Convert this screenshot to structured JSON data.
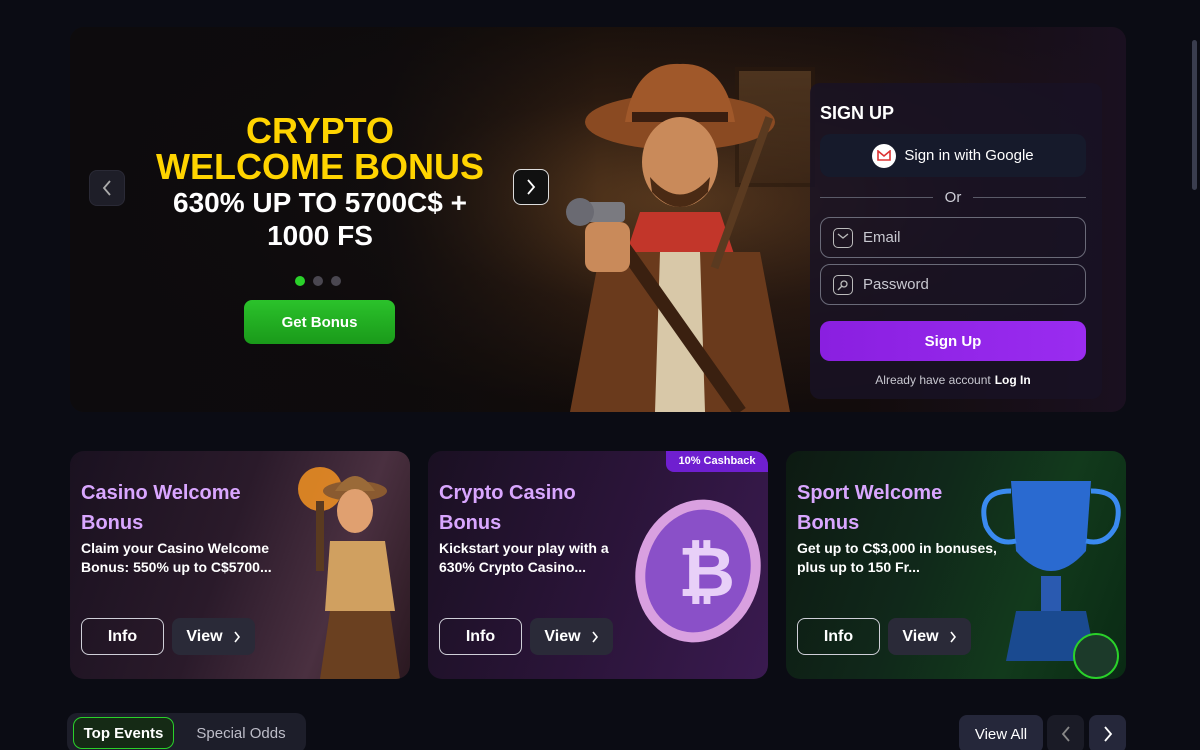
{
  "hero": {
    "promo_line1": "CRYPTO",
    "promo_line2": "WELCOME BONUS",
    "promo_line3": "630% UP TO 5700C$ +",
    "promo_line4": "1000 FS",
    "cta_label": "Get Bonus",
    "slides": 3,
    "active_slide": 1
  },
  "signup": {
    "title": "SIGN UP",
    "google_label": "Sign in with Google",
    "or_label": "Or",
    "email_placeholder": "Email",
    "password_placeholder": "Password",
    "submit_label": "Sign Up",
    "already_text": "Already have account",
    "login_label": "Log In"
  },
  "cards": [
    {
      "title": "Casino Welcome Bonus",
      "desc": "Claim your Casino Welcome Bonus: 550% up to C$5700...",
      "info_label": "Info",
      "view_label": "View"
    },
    {
      "title": "Crypto Casino Bonus",
      "desc": "Kickstart your play with a 630% Crypto Casino...",
      "badge": "10% Cashback",
      "info_label": "Info",
      "view_label": "View"
    },
    {
      "title": "Sport Welcome Bonus",
      "desc": "Get up to C$3,000 in bonuses, plus up to 150 Fr...",
      "info_label": "Info",
      "view_label": "View"
    }
  ],
  "events": {
    "tabs": [
      "Top Events",
      "Special Odds"
    ],
    "active_tab": "Top Events",
    "view_all_label": "View All"
  },
  "colors": {
    "accent_green": "#2ad12a",
    "accent_purple": "#8a1fe0",
    "promo_yellow": "#ffd400",
    "card_title": "#d9a6ff"
  }
}
